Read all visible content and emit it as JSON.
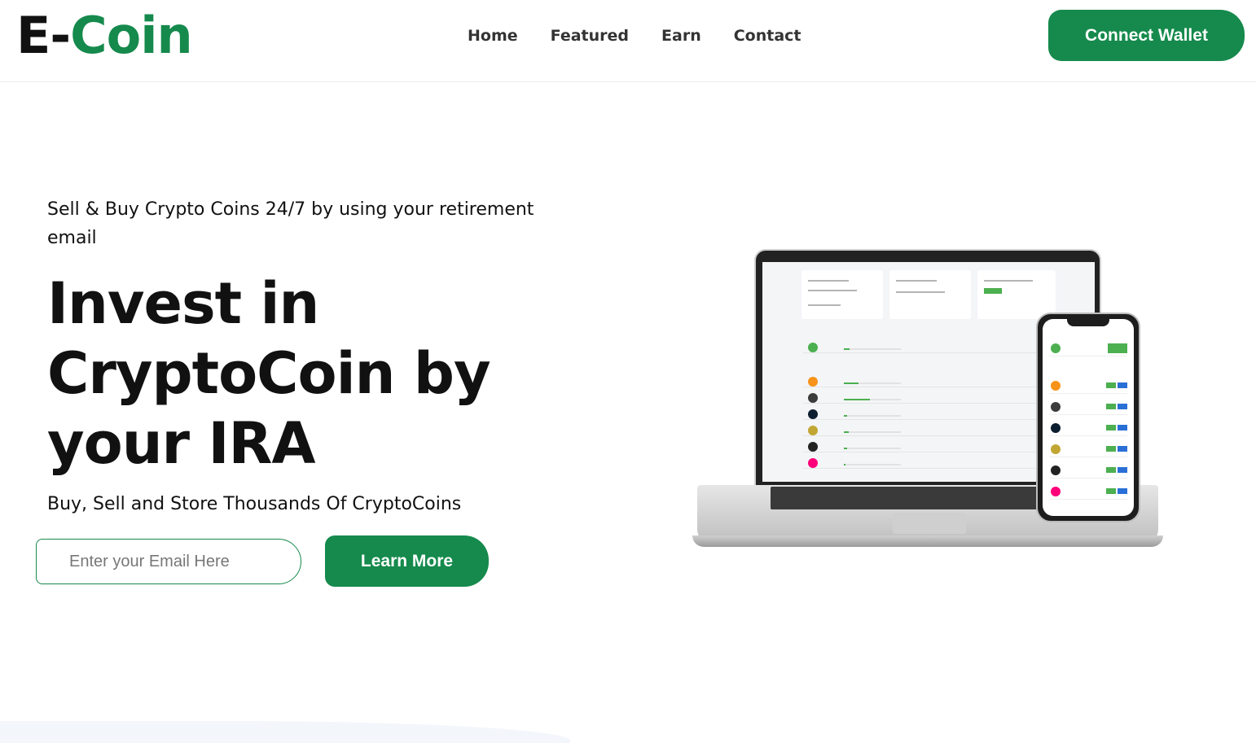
{
  "brand": {
    "prefix": "E-",
    "name": "Coin"
  },
  "nav": {
    "items": [
      {
        "label": "Home"
      },
      {
        "label": "Featured"
      },
      {
        "label": "Earn"
      },
      {
        "label": "Contact"
      }
    ]
  },
  "header": {
    "connect_label": "Connect Wallet"
  },
  "hero": {
    "tagline": "Sell & Buy Crypto Coins 24/7 by using your retirement email",
    "headline": "Invest in CryptoCoin by your IRA",
    "subhead": "Buy, Sell and Store Thousands Of CryptoCoins",
    "email_placeholder": "Enter your Email Here",
    "cta_label": "Learn More"
  },
  "colors": {
    "brand_green": "#158a4c"
  }
}
